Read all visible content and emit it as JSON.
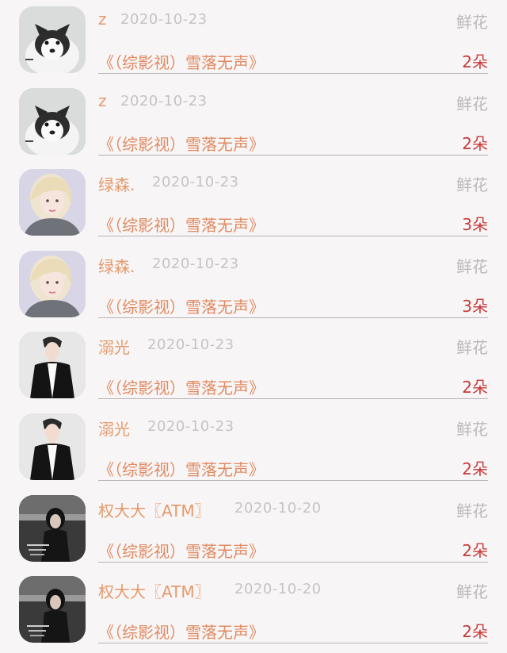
{
  "records": [
    {
      "name": "z",
      "date": "2020-10-23",
      "gift": "鲜花",
      "title": "《（综影视）雪落无声》",
      "count": "2朵",
      "avatar": "husky-avatar"
    },
    {
      "name": "z",
      "date": "2020-10-23",
      "gift": "鲜花",
      "title": "《（综影视）雪落无声》",
      "count": "2朵",
      "avatar": "husky-avatar"
    },
    {
      "name": "绿森.",
      "date": "2020-10-23",
      "gift": "鲜花",
      "title": "《（综影视）雪落无声》",
      "count": "3朵",
      "avatar": "blonde-girl-avatar"
    },
    {
      "name": "绿森.",
      "date": "2020-10-23",
      "gift": "鲜花",
      "title": "《（综影视）雪落无声》",
      "count": "3朵",
      "avatar": "blonde-girl-avatar"
    },
    {
      "name": "溺光",
      "date": "2020-10-23",
      "gift": "鲜花",
      "title": "《（综影视）雪落无声》",
      "count": "2朵",
      "avatar": "man-in-suit-avatar"
    },
    {
      "name": "溺光",
      "date": "2020-10-23",
      "gift": "鲜花",
      "title": "《（综影视）雪落无声》",
      "count": "2朵",
      "avatar": "man-in-suit-avatar"
    },
    {
      "name": "权大大〖ATM〗",
      "date": "2020-10-20",
      "gift": "鲜花",
      "title": "《（综影视）雪落无声》",
      "count": "2朵",
      "avatar": "dark-girl-avatar"
    },
    {
      "name": "权大大〖ATM〗",
      "date": "2020-10-20",
      "gift": "鲜花",
      "title": "《（综影视）雪落无声》",
      "count": "2朵",
      "avatar": "dark-girl-avatar"
    }
  ]
}
